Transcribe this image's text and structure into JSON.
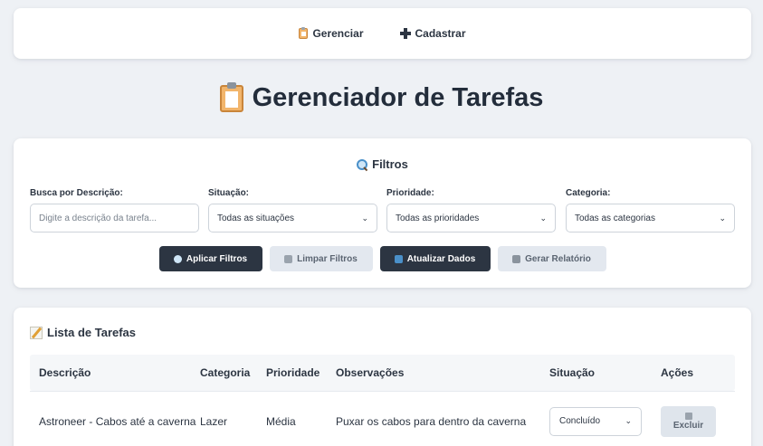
{
  "nav": {
    "items": [
      {
        "label": "Gerenciar",
        "icon": "clipboard-icon"
      },
      {
        "label": "Cadastrar",
        "icon": "plus-icon"
      }
    ]
  },
  "page": {
    "title": "Gerenciador de Tarefas",
    "title_icon": "clipboard-icon"
  },
  "filters": {
    "title": "Filtros",
    "search": {
      "label": "Busca por Descrição:",
      "placeholder": "Digite a descrição da tarefa..."
    },
    "situacao": {
      "label": "Situação:",
      "value": "Todas as situações"
    },
    "prioridade": {
      "label": "Prioridade:",
      "value": "Todas as prioridades"
    },
    "categoria": {
      "label": "Categoria:",
      "value": "Todas as categorias"
    },
    "buttons": {
      "apply": "Aplicar Filtros",
      "clear": "Limpar Filtros",
      "refresh": "Atualizar Dados",
      "report": "Gerar Relatório"
    }
  },
  "list": {
    "title": "Lista de Tarefas",
    "headers": [
      "Descrição",
      "Categoria",
      "Prioridade",
      "Observações",
      "Situação",
      "Ações"
    ],
    "rows": [
      {
        "descricao": "Astroneer - Cabos até a caverna",
        "categoria": "Lazer",
        "prioridade": "Média",
        "observacoes": "Puxar os cabos para dentro da caverna",
        "situacao": "Concluído",
        "acao": "Excluir"
      }
    ]
  },
  "colors": {
    "dark": "#2c3542",
    "light_button": "#e3e8ef",
    "background": "#eef1f5"
  }
}
